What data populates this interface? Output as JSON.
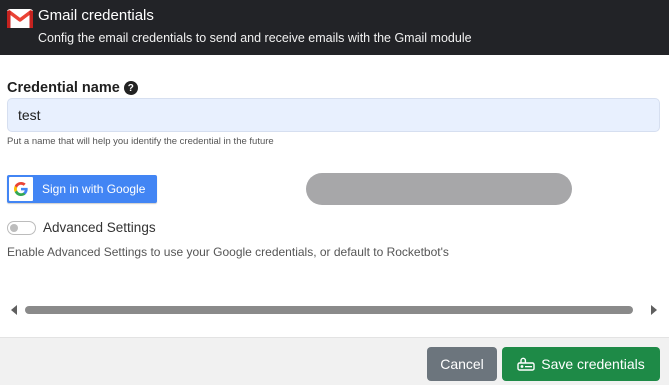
{
  "header": {
    "title": "Gmail credentials",
    "subtitle": "Config the email credentials to send and receive emails with the Gmail module",
    "logo_icon": "gmail-icon"
  },
  "form": {
    "credential_label": "Credential name",
    "help_icon": "question-circle-icon",
    "credential_value": "test",
    "credential_help": "Put a name that will help you identify the credential in the future"
  },
  "google_button": {
    "label": "Sign in with Google",
    "icon": "google-g-icon"
  },
  "advanced": {
    "label": "Advanced Settings",
    "enabled": false,
    "description": "Enable Advanced Settings to use your Google credentials, or default to Rocketbot's"
  },
  "footer": {
    "cancel_label": "Cancel",
    "save_label": "Save credentials",
    "save_icon": "key-icon"
  },
  "colors": {
    "header_bg": "#222327",
    "input_bg": "#e8f0fe",
    "google_blue": "#4285f4",
    "cancel_gray": "#6c757d",
    "save_green": "#1e8a47"
  }
}
